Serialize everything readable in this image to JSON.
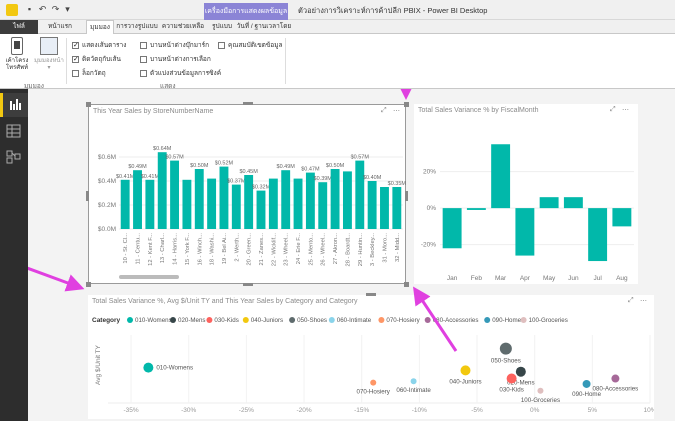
{
  "window": {
    "title": "ตัวอย่างการวิเคราะห์การค้าปลีก PBIX - Power BI Desktop",
    "context_tab": "เครื่องมือการแสดงผลข้อมูล"
  },
  "tabs": [
    {
      "label": "ไฟล์"
    },
    {
      "label": "หน้าแรก"
    },
    {
      "label": "มุมมอง"
    },
    {
      "label": "การวางรูปแบบ"
    },
    {
      "label": "ความช่วยเหลือ"
    },
    {
      "label": "รูปแบบ"
    },
    {
      "label": "วันที่ / ฐานเวลาโดย"
    }
  ],
  "ribbon": {
    "big_buttons": [
      {
        "label": "เค้าโครงโทรศัพท์"
      },
      {
        "label": "มุมมองหน้า"
      }
    ],
    "group1_label": "มุมมอง",
    "checkboxes_col1": [
      {
        "label": "แสดงเส้นตาราง",
        "checked": true
      },
      {
        "label": "ติดวัตถุกับเส้น",
        "checked": true
      },
      {
        "label": "ล็อกวัตถุ",
        "checked": false
      }
    ],
    "checkboxes_col2": [
      {
        "label": "บานหน้าต่างบุ๊กมาร์ก",
        "checked": false
      },
      {
        "label": "บานหน้าต่างการเลือก",
        "checked": false
      },
      {
        "label": "ตัวแบ่งส่วนข้อมูลการซิงค์",
        "checked": false
      }
    ],
    "checkboxes_col3": [
      {
        "label": "คุณสมบัติเขตข้อมูล",
        "checked": false
      }
    ],
    "group2_label": "แสดง"
  },
  "visual_top_left": {
    "title": "This Year Sales by StoreNumberName",
    "chart_data": {
      "type": "bar",
      "color": "#01b8aa",
      "y_ticks": [
        "$0.6M",
        "$0.4M",
        "$0.2M",
        "$0.0M"
      ],
      "ylim": [
        0,
        0.7
      ],
      "categories": [
        "10 - St. Cl...",
        "11 - Centu...",
        "12 - Kent F...",
        "13 - Charl...",
        "14 - Harris...",
        "15 - York F...",
        "16 - Winch...",
        "18 - Washi...",
        "19 - Bel Ai...",
        "2 - Werth...",
        "20 - Green...",
        "21 - Zanes...",
        "22 - Wicklif...",
        "23 - Wheel...",
        "24 - Erie F...",
        "25 - Mento...",
        "26 - Wheel...",
        "27 - Akron...",
        "28 - Boardt...",
        "29 - Huntin...",
        "3 - Beckley...",
        "31 - Moro...",
        "32 - Midd..."
      ],
      "values": [
        0.41,
        0.49,
        0.41,
        0.64,
        0.57,
        0.41,
        0.5,
        0.42,
        0.52,
        0.37,
        0.45,
        0.32,
        0.42,
        0.49,
        0.42,
        0.47,
        0.39,
        0.5,
        0.48,
        0.57,
        0.4,
        0.35,
        0.35
      ],
      "data_labels": [
        "$0.41M",
        "$0.49M",
        "$0.41M",
        "$0.64M",
        "$0.57M",
        "",
        "$0.50M",
        "",
        "$0.52M",
        "$0.37M",
        "$0.45M",
        "$0.32M",
        "",
        "$0.49M",
        "",
        "$0.47M",
        "$0.39M",
        "$0.50M",
        "",
        "$0.57M",
        "$0.40M",
        "",
        "$0.35M"
      ]
    }
  },
  "visual_top_right": {
    "title": "Total Sales Variance % by FiscalMonth",
    "chart_data": {
      "type": "bar",
      "color": "#01b8aa",
      "y_ticks": [
        "20%",
        "0%",
        "-20%"
      ],
      "ylim": [
        -35,
        45
      ],
      "categories": [
        "Jan",
        "Feb",
        "Mar",
        "Apr",
        "May",
        "Jun",
        "Jul",
        "Aug"
      ],
      "values": [
        -22,
        -1,
        35,
        -26,
        6,
        6,
        -29,
        -10
      ]
    }
  },
  "visual_bottom": {
    "title": "Total Sales Variance %, Avg $/Unit TY and This Year Sales by Category and Category",
    "legend_title": "Category",
    "y_axis_label": "Avg $/Unit TY",
    "chart_data": {
      "type": "scatter",
      "x_ticks": [
        "-35%",
        "-30%",
        "-25%",
        "-20%",
        "-15%",
        "-10%",
        "-5%",
        "0%",
        "5%",
        "10%"
      ],
      "xlim": [
        -37,
        10
      ],
      "series": [
        {
          "name": "010-Womens",
          "color": "#01b8aa",
          "x": -33.5,
          "y": 13,
          "r": 5
        },
        {
          "name": "020-Mens",
          "color": "#374649",
          "x": -1.2,
          "y": 11.5,
          "r": 5
        },
        {
          "name": "030-Kids",
          "color": "#fd625e",
          "x": -2,
          "y": 9,
          "r": 5
        },
        {
          "name": "040-Juniors",
          "color": "#f2c80f",
          "x": -6,
          "y": 12,
          "r": 5
        },
        {
          "name": "050-Shoes",
          "color": "#5f6b6d",
          "x": -2.5,
          "y": 20,
          "r": 6
        },
        {
          "name": "060-Intimate",
          "color": "#8ad4eb",
          "x": -10.5,
          "y": 8,
          "r": 3
        },
        {
          "name": "070-Hosiery",
          "color": "#fe9666",
          "x": -14,
          "y": 7.5,
          "r": 3
        },
        {
          "name": "080-Accessories",
          "color": "#a66999",
          "x": 7,
          "y": 9,
          "r": 4
        },
        {
          "name": "090-Home",
          "color": "#3599b8",
          "x": 4.5,
          "y": 7,
          "r": 4
        },
        {
          "name": "100-Groceries",
          "color": "#dfbfbf",
          "x": 0.5,
          "y": 4.5,
          "r": 3
        }
      ],
      "ylim": [
        0,
        25
      ]
    }
  }
}
